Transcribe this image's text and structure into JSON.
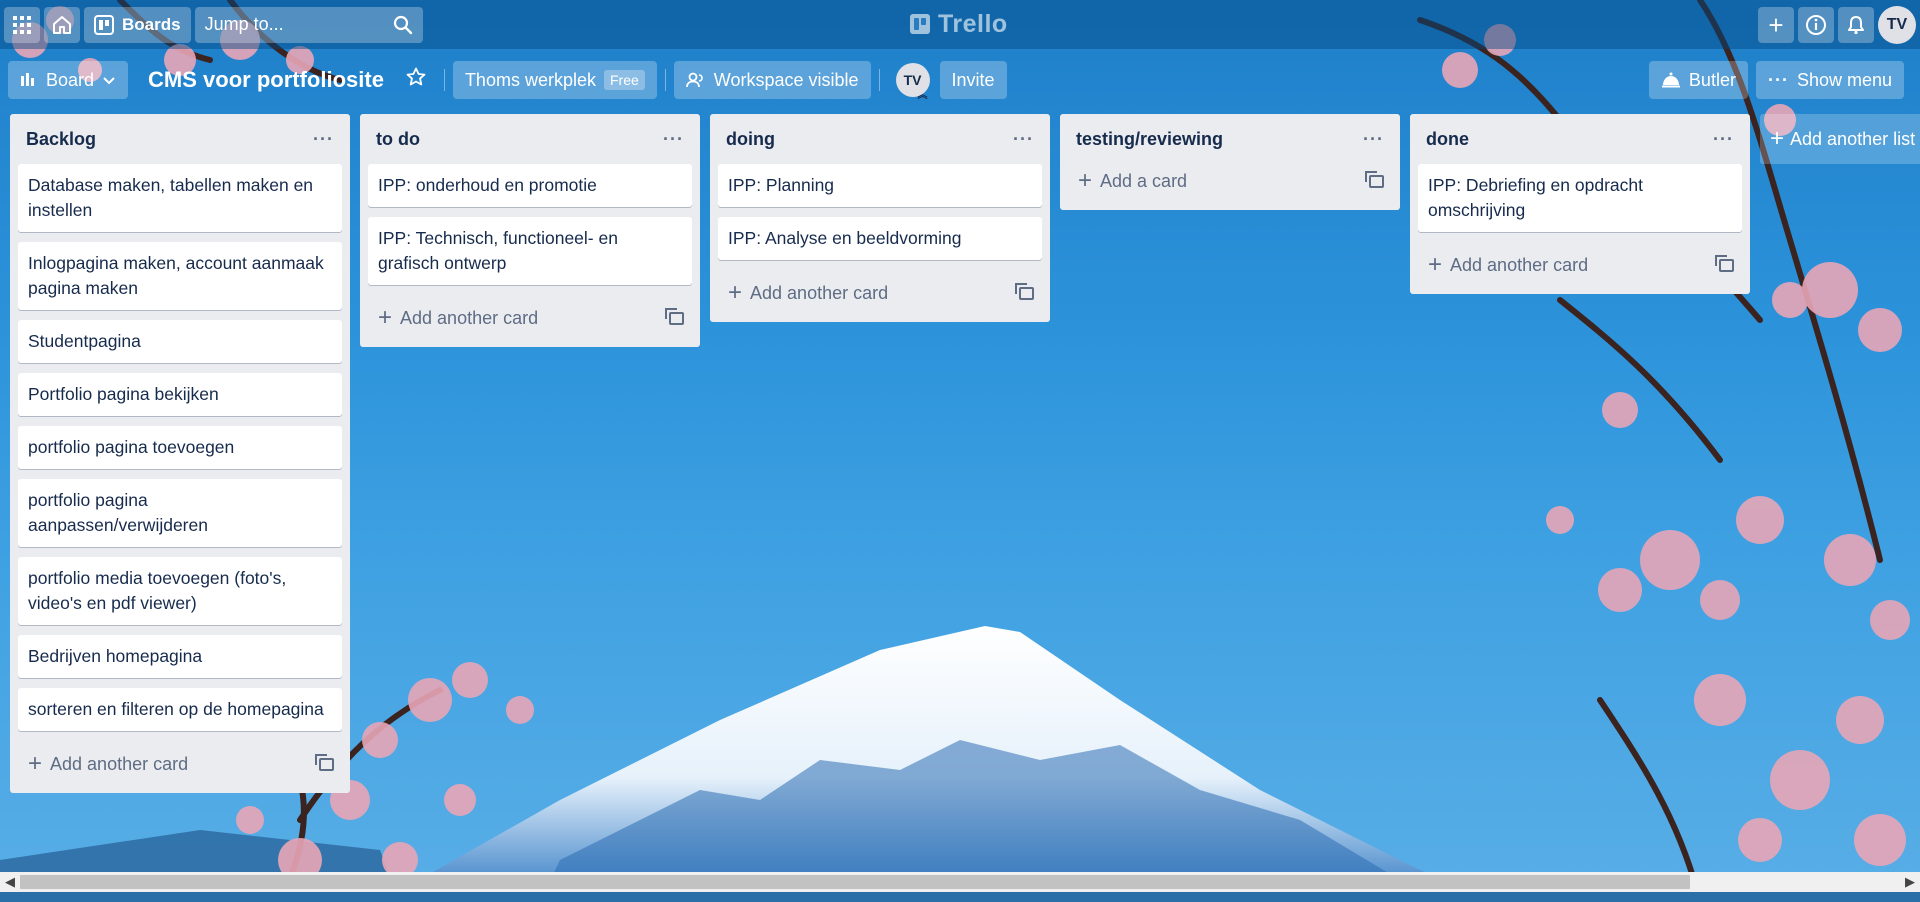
{
  "topbar": {
    "boards_label": "Boards",
    "search_placeholder": "Jump to...",
    "logo_text": "Trello",
    "avatar_initials": "TV"
  },
  "header": {
    "view_label": "Board",
    "board_title": "CMS voor portfoliosite",
    "workspace_label": "Thoms werkplek",
    "workspace_badge": "Free",
    "visibility_label": "Workspace visible",
    "member_initials": "TV",
    "invite_label": "Invite",
    "butler_label": "Butler",
    "menu_label": "Show menu"
  },
  "lists": [
    {
      "title": "Backlog",
      "cards": [
        "Database maken, tabellen maken en instellen",
        "Inlogpagina maken, account aanmaak pagina maken",
        "Studentpagina",
        "Portfolio pagina bekijken",
        "portfolio pagina toevoegen",
        "portfolio pagina aanpassen/verwijderen",
        "portfolio media toevoegen (foto's, video's en pdf viewer)",
        "Bedrijven homepagina",
        "sorteren en filteren op de homepagina"
      ],
      "add_label": "Add another card"
    },
    {
      "title": "to do",
      "cards": [
        "IPP: onderhoud en promotie",
        "IPP: Technisch, functioneel- en grafisch ontwerp"
      ],
      "add_label": "Add another card"
    },
    {
      "title": "doing",
      "cards": [
        "IPP: Planning",
        "IPP: Analyse en beeldvorming"
      ],
      "add_label": "Add another card"
    },
    {
      "title": "testing/reviewing",
      "cards": [],
      "add_label": "Add a card"
    },
    {
      "title": "done",
      "cards": [
        "IPP: Debriefing en opdracht omschrijving"
      ],
      "add_label": "Add another card"
    }
  ],
  "add_list_label": "Add another list"
}
